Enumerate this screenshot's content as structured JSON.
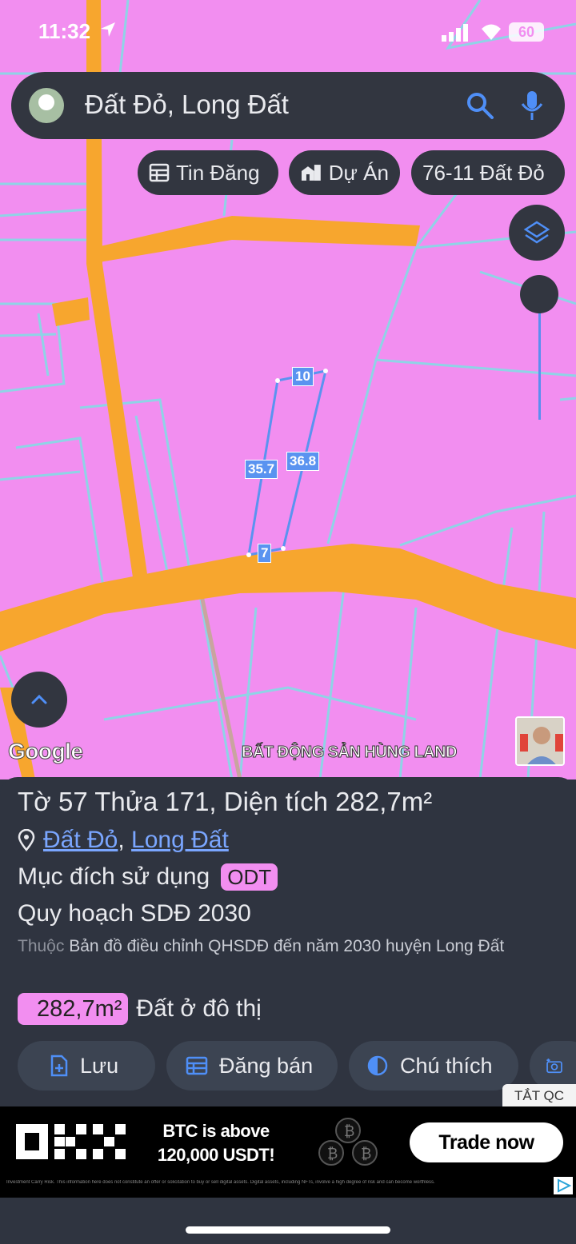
{
  "status_bar": {
    "time": "11:32",
    "battery": "60"
  },
  "search": {
    "query": "Đất Đỏ, Long Đất"
  },
  "chips": [
    {
      "label": "Tin Đăng",
      "icon": "table-icon"
    },
    {
      "label": "Dự Án",
      "icon": "buildings-icon"
    },
    {
      "label": "76-11 Đất Đỏ",
      "icon": ""
    }
  ],
  "map": {
    "parcel_dimensions": {
      "top": "10",
      "left": "35.7",
      "right": "36.8",
      "bottom": "7"
    },
    "google_logo": "Google",
    "watermark": "BẤT ĐỘNG SẢN HÙNG LAND",
    "colors": {
      "residential_land": "#f28ef0",
      "road": "#f7a62e",
      "parcel_outline": "#5a93f0"
    }
  },
  "panel": {
    "title": "Tờ 57 Thửa 171, Diện tích 282,7m²",
    "location": {
      "district": "Đất Đỏ",
      "separator": ", ",
      "province": "Long Đất"
    },
    "purpose_label": "Mục đích sử dụng",
    "purpose_code": "ODT",
    "planning": "Quy hoạch SDĐ 2030",
    "source_prefix": "Thuộc",
    "source_text": " Bản đồ điều chỉnh QHSDĐ đến năm 2030 huyện Long Đất",
    "area_value": "282,7m²",
    "area_type": "Đất ở đô thị",
    "actions": [
      {
        "label": "Lưu",
        "icon": "add-document-icon"
      },
      {
        "label": "Đăng bán",
        "icon": "table-icon"
      },
      {
        "label": "Chú thích",
        "icon": "half-circle-icon"
      }
    ],
    "hide_ads": "TẮT QC"
  },
  "ad": {
    "brand": "OKX",
    "line1": "BTC is above",
    "line2": "120,000 USDT!",
    "cta": "Trade now",
    "disclaimer": "Investment Carry Risk. This information here does not constitute an offer or solicitation to buy or sell digital assets. Digital assets, including NFTs, involve a high degree of risk and can become worthless."
  }
}
